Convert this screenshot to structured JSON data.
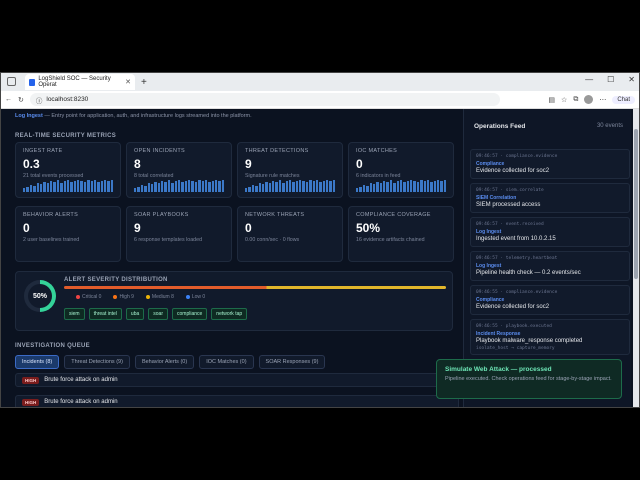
{
  "browser": {
    "tab_title": "LogShield SOC — Security Operat",
    "url": "localhost:8230",
    "chat_label": "Chat"
  },
  "topline": {
    "label": "Log Ingest",
    "text": "— Entry point for application, auth, and infrastructure logs streamed into the platform."
  },
  "metrics": {
    "section": "REAL-TIME SECURITY METRICS",
    "cards": [
      {
        "title": "INGEST RATE",
        "value": "0.3",
        "sub": "21 total events processed",
        "spark": true
      },
      {
        "title": "OPEN INCIDENTS",
        "value": "8",
        "sub": "8 total correlated",
        "spark": true
      },
      {
        "title": "THREAT DETECTIONS",
        "value": "9",
        "sub": "Signature rule matches",
        "spark": true
      },
      {
        "title": "IOC MATCHES",
        "value": "0",
        "sub": "6 indicators in feed",
        "spark": true
      },
      {
        "title": "BEHAVIOR ALERTS",
        "value": "0",
        "sub": "2 user baselines trained",
        "spark": false
      },
      {
        "title": "SOAR PLAYBOOKS",
        "value": "9",
        "sub": "6 response templates loaded",
        "spark": false
      },
      {
        "title": "NETWORK THREATS",
        "value": "0",
        "sub": "0.00 conn/sec · 0 flows",
        "spark": false
      },
      {
        "title": "COMPLIANCE COVERAGE",
        "value": "50%",
        "sub": "16 evidence artifacts chained",
        "spark": false
      }
    ]
  },
  "severity": {
    "title": "ALERT SEVERITY DISTRIBUTION",
    "ring": "50%",
    "ring_fraction": 0.5,
    "legend": [
      {
        "label": "Critical 0",
        "color": "#ef4444"
      },
      {
        "label": "High 9",
        "color": "#f97316"
      },
      {
        "label": "Medium 8",
        "color": "#eab308"
      },
      {
        "label": "Low 0",
        "color": "#3b82f6"
      }
    ],
    "chips": [
      "siem",
      "threat intel",
      "uba",
      "soar",
      "compliance",
      "network tap"
    ]
  },
  "queue": {
    "section": "INVESTIGATION QUEUE",
    "tabs": [
      "Incidents (8)",
      "Threat Detections (9)",
      "Behavior Alerts (0)",
      "IOC Matches (0)",
      "SOAR Responses (9)"
    ],
    "rows": [
      {
        "severity": "HIGH",
        "title": "Brute force attack on admin"
      },
      {
        "severity": "HIGH",
        "title": "Brute force attack on admin"
      }
    ]
  },
  "feed": {
    "title": "Operations Feed",
    "count": "30 events",
    "events": [
      {
        "ts": "09:46:57 · compliance.evidence",
        "type": "Compliance",
        "msg": "Evidence collected for soc2",
        "tag": ""
      },
      {
        "ts": "09:46:57 · siem.correlate",
        "type": "SIEM Correlation",
        "msg": "SIEM processed access",
        "tag": ""
      },
      {
        "ts": "09:46:57 · event.received",
        "type": "Log Ingest",
        "msg": "Ingested event from 10.0.2.15",
        "tag": ""
      },
      {
        "ts": "09:46:57 · telemetry.heartbeat",
        "type": "Log Ingest",
        "msg": "Pipeline health check — 0.2 events/sec",
        "tag": ""
      },
      {
        "ts": "09:46:55 · compliance.evidence",
        "type": "Compliance",
        "msg": "Evidence collected for soc2",
        "tag": ""
      },
      {
        "ts": "09:46:55 · playbook.executed",
        "type": "Incident Response",
        "msg": "Playbook malware_response completed",
        "tag": "isolate_host → capture_memory"
      }
    ]
  },
  "toast": {
    "title": "Simulate Web Attack — processed",
    "body": "Pipeline executed. Check operations feed for stage-by-stage impact."
  }
}
